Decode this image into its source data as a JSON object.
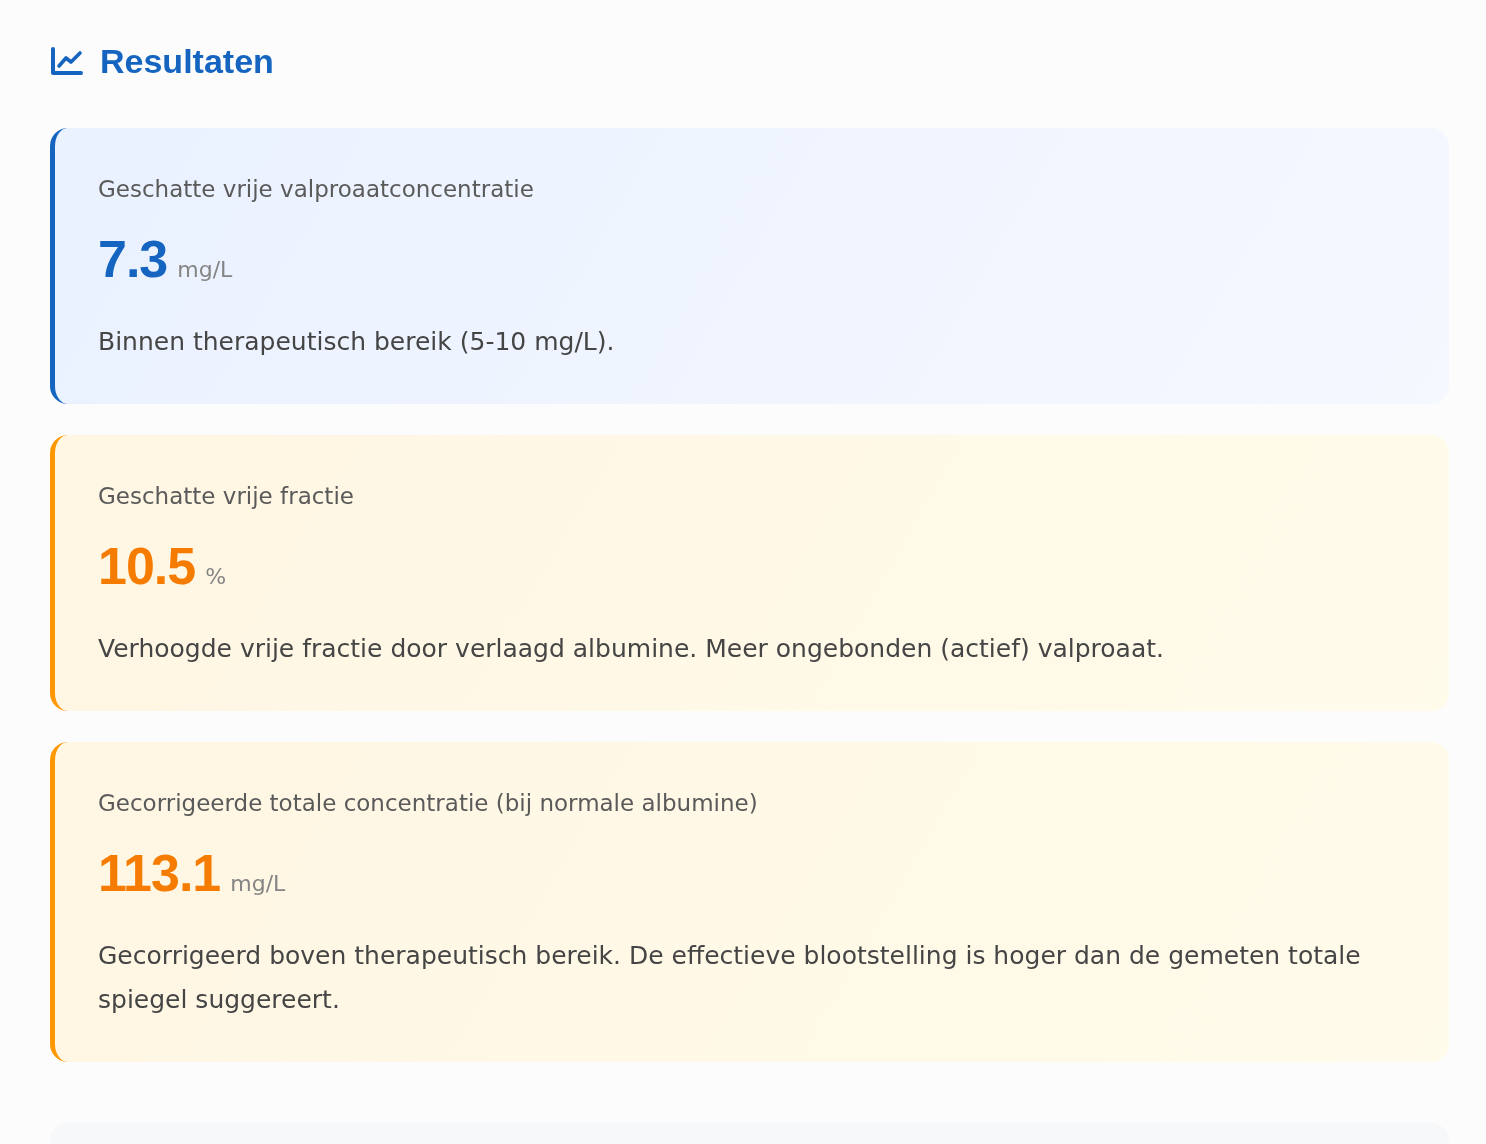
{
  "section": {
    "title": "Resultaten"
  },
  "cards": [
    {
      "kind": "info",
      "label": "Geschatte vrije valproaatconcentratie",
      "value": "7.3",
      "unit": "mg/L",
      "description": "Binnen therapeutisch bereik (5-10 mg/L)."
    },
    {
      "kind": "warning",
      "label": "Geschatte vrije fractie",
      "value": "10.5",
      "unit": "%",
      "description": "Verhoogde vrije fractie door verlaagd albumine. Meer ongebonden (actief) valproaat."
    },
    {
      "kind": "warning",
      "label": "Gecorrigeerde totale concentratie (bij normale albumine)",
      "value": "113.1",
      "unit": "mg/L",
      "description": "Gecorrigeerd boven therapeutisch bereik. De effectieve blootstelling is hoger dan de gemeten totale spiegel suggereert."
    }
  ]
}
